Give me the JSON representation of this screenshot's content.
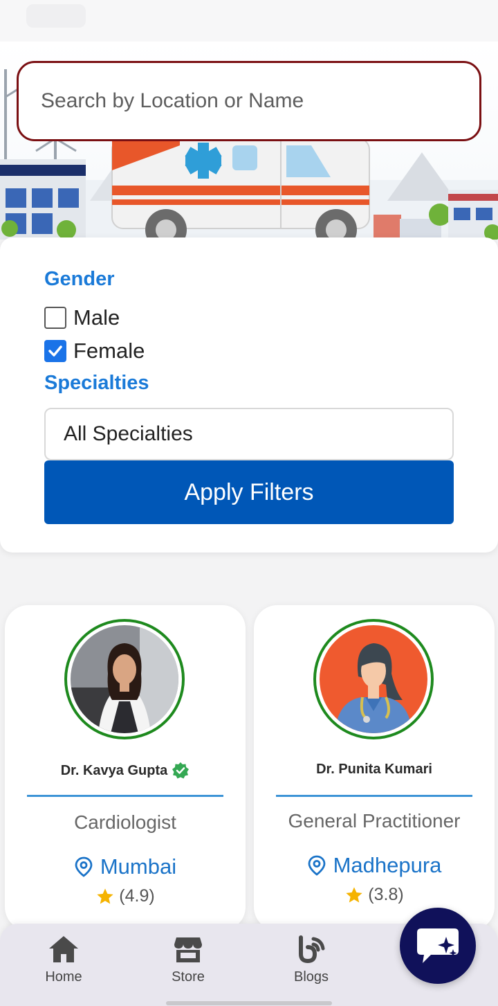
{
  "search": {
    "placeholder": "Search by Location or Name"
  },
  "filters": {
    "gender_title": "Gender",
    "gender_options": [
      {
        "label": "Male",
        "checked": false
      },
      {
        "label": "Female",
        "checked": true
      }
    ],
    "specialties_title": "Specialties",
    "specialty_selected": "All Specialties",
    "apply_label": "Apply Filters"
  },
  "doctors": [
    {
      "name": "Dr. Kavya Gupta",
      "verified": true,
      "specialty": "Cardiologist",
      "location": "Mumbai",
      "rating": "(4.9)"
    },
    {
      "name": "Dr. Punita Kumari",
      "verified": false,
      "specialty": "General Practitioner",
      "location": "Madhepura",
      "rating": "(3.8)"
    }
  ],
  "nav": {
    "items": [
      {
        "label": "Home",
        "icon": "home-icon"
      },
      {
        "label": "Store",
        "icon": "store-icon"
      },
      {
        "label": "Blogs",
        "icon": "blogs-icon"
      },
      {
        "label": "AI",
        "icon": "ai-icon"
      }
    ]
  },
  "colors": {
    "accent": "#1a7ad8",
    "button": "#0057b7",
    "search_border": "#7a0f12",
    "verified": "#34a853",
    "star": "#f5b301",
    "fab": "#10115a"
  }
}
